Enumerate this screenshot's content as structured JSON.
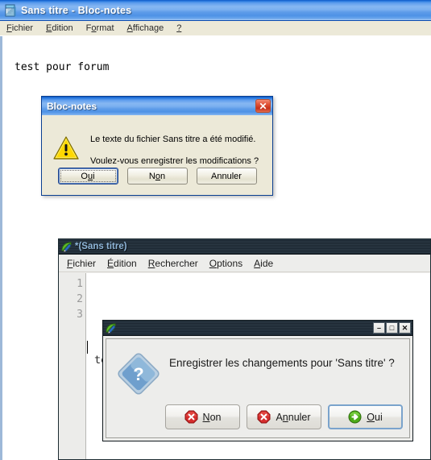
{
  "xp_window": {
    "icon": "notepad-icon",
    "title": "Sans titre - Bloc-notes",
    "menus": [
      {
        "pre": "",
        "key": "F",
        "post": "ichier"
      },
      {
        "pre": "",
        "key": "E",
        "post": "dition"
      },
      {
        "pre": "F",
        "key": "o",
        "post": "rmat"
      },
      {
        "pre": "",
        "key": "A",
        "post": "ffichage"
      },
      {
        "pre": "",
        "key": "?",
        "post": ""
      }
    ],
    "document_text": "test pour forum"
  },
  "xp_dialog": {
    "title": "Bloc-notes",
    "close_label": "✕",
    "icon": "warning-triangle-icon",
    "message_line1": "Le texte du fichier Sans titre a été modifié.",
    "message_line2": "Voulez-vous enregistrer les modifications ?",
    "buttons": [
      {
        "pre": "O",
        "key": "u",
        "post": "i",
        "default": true
      },
      {
        "pre": "N",
        "key": "o",
        "post": "n",
        "default": false
      },
      {
        "pre": "Annuler",
        "key": "",
        "post": "",
        "default": false
      }
    ]
  },
  "gtk_window": {
    "icon": "leafpad-icon",
    "title": "*(Sans titre)",
    "menus": [
      {
        "pre": "",
        "key": "F",
        "post": "ichier"
      },
      {
        "pre": "",
        "key": "É",
        "post": "dition"
      },
      {
        "pre": "",
        "key": "R",
        "post": "echercher"
      },
      {
        "pre": "",
        "key": "O",
        "post": "ptions"
      },
      {
        "pre": "",
        "key": "A",
        "post": "ide"
      }
    ],
    "line_numbers": [
      "1",
      "2",
      "3"
    ],
    "document_lines": [
      "",
      "test pour forum",
      ""
    ]
  },
  "gtk_dialog": {
    "icon": "leafpad-icon",
    "window_buttons": [
      {
        "name": "minimize-button",
        "glyph": "–"
      },
      {
        "name": "maximize-button",
        "glyph": "□"
      },
      {
        "name": "close-button",
        "glyph": "✕"
      }
    ],
    "icon_question": "question-diamond-icon",
    "message": "Enregistrer les changements pour 'Sans titre' ?",
    "buttons": [
      {
        "icon": "cancel-red-icon",
        "pre": "",
        "key": "N",
        "post": "on",
        "focused": false
      },
      {
        "icon": "cancel-red-icon",
        "pre": "A",
        "key": "n",
        "post": "nuler",
        "focused": false
      },
      {
        "icon": "ok-green-arrow-icon",
        "pre": "",
        "key": "O",
        "post": "ui",
        "focused": true
      }
    ]
  },
  "colors": {
    "xp_titlebar_blue": "#2d7ce0",
    "xp_face": "#ece9d8",
    "gtk_titlebar_dark": "#23303a",
    "gtk_title_text": "#8fb6d8",
    "gtk_face": "#ededeb",
    "warning_yellow": "#ffd800",
    "question_blue": "#6f9fcd",
    "error_red": "#cc2222",
    "ok_green": "#4caa18"
  }
}
